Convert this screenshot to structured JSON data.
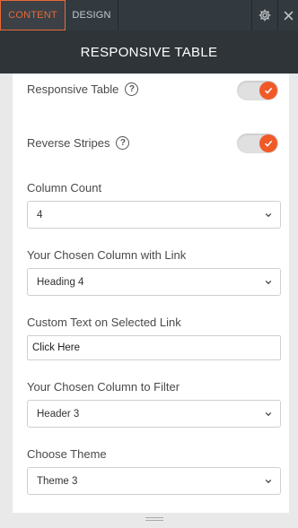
{
  "tabs": {
    "content_label": "CONTENT",
    "design_label": "DESIGN",
    "settings_icon": "gear-icon",
    "close_icon": "close-icon"
  },
  "header": {
    "title": "RESPONSIVE TABLE"
  },
  "toggles": [
    {
      "label": "Responsive Table",
      "on": true,
      "help_icon": "question-circle-icon"
    },
    {
      "label": "Reverse Stripes",
      "on": true,
      "help_icon": "question-circle-icon"
    }
  ],
  "fields": {
    "column_count": {
      "label": "Column Count",
      "value": "4"
    },
    "link_column": {
      "label": "Your Chosen Column with Link",
      "value": "Heading 4"
    },
    "custom_text": {
      "label": "Custom Text on Selected Link",
      "value": "Click Here"
    },
    "filter_column": {
      "label": "Your Chosen Column to Filter",
      "value": "Header 3"
    },
    "theme": {
      "label": "Choose Theme",
      "value": "Theme 3"
    }
  },
  "colors": {
    "accent": "#f05a28",
    "tab_active_border": "#e86a3a",
    "header_bg": "#2f3438",
    "tabbar_bg": "#333a3f"
  }
}
